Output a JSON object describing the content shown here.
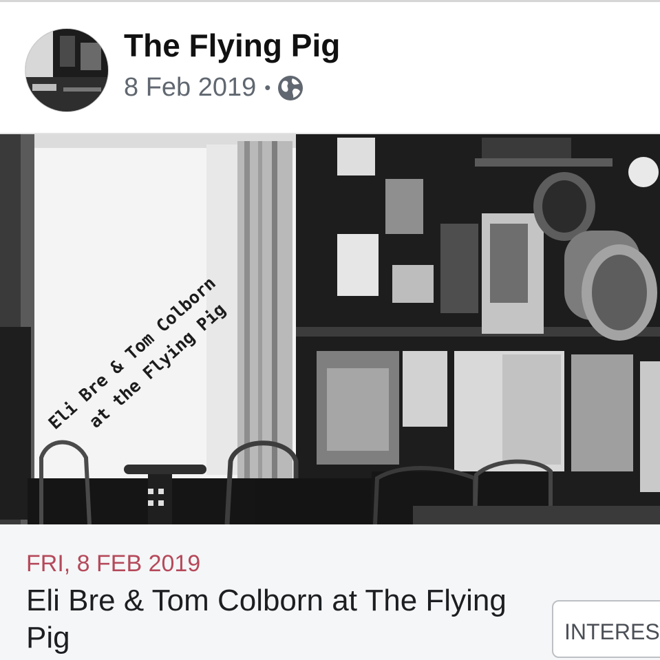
{
  "post": {
    "page_name": "The Flying Pig",
    "date": "8 Feb 2019",
    "separator": "•",
    "privacy_icon": "globe-icon"
  },
  "photo": {
    "overlay_line1": "Eli Bre & Tom Colborn",
    "overlay_line2": "   at the Flying Pig"
  },
  "event": {
    "date_label": "FRI, 8 FEB 2019",
    "title": "Eli Bre & Tom Colborn at The Flying Pig",
    "interested_label": "INTERESTED",
    "date_color": "#b5495b"
  }
}
